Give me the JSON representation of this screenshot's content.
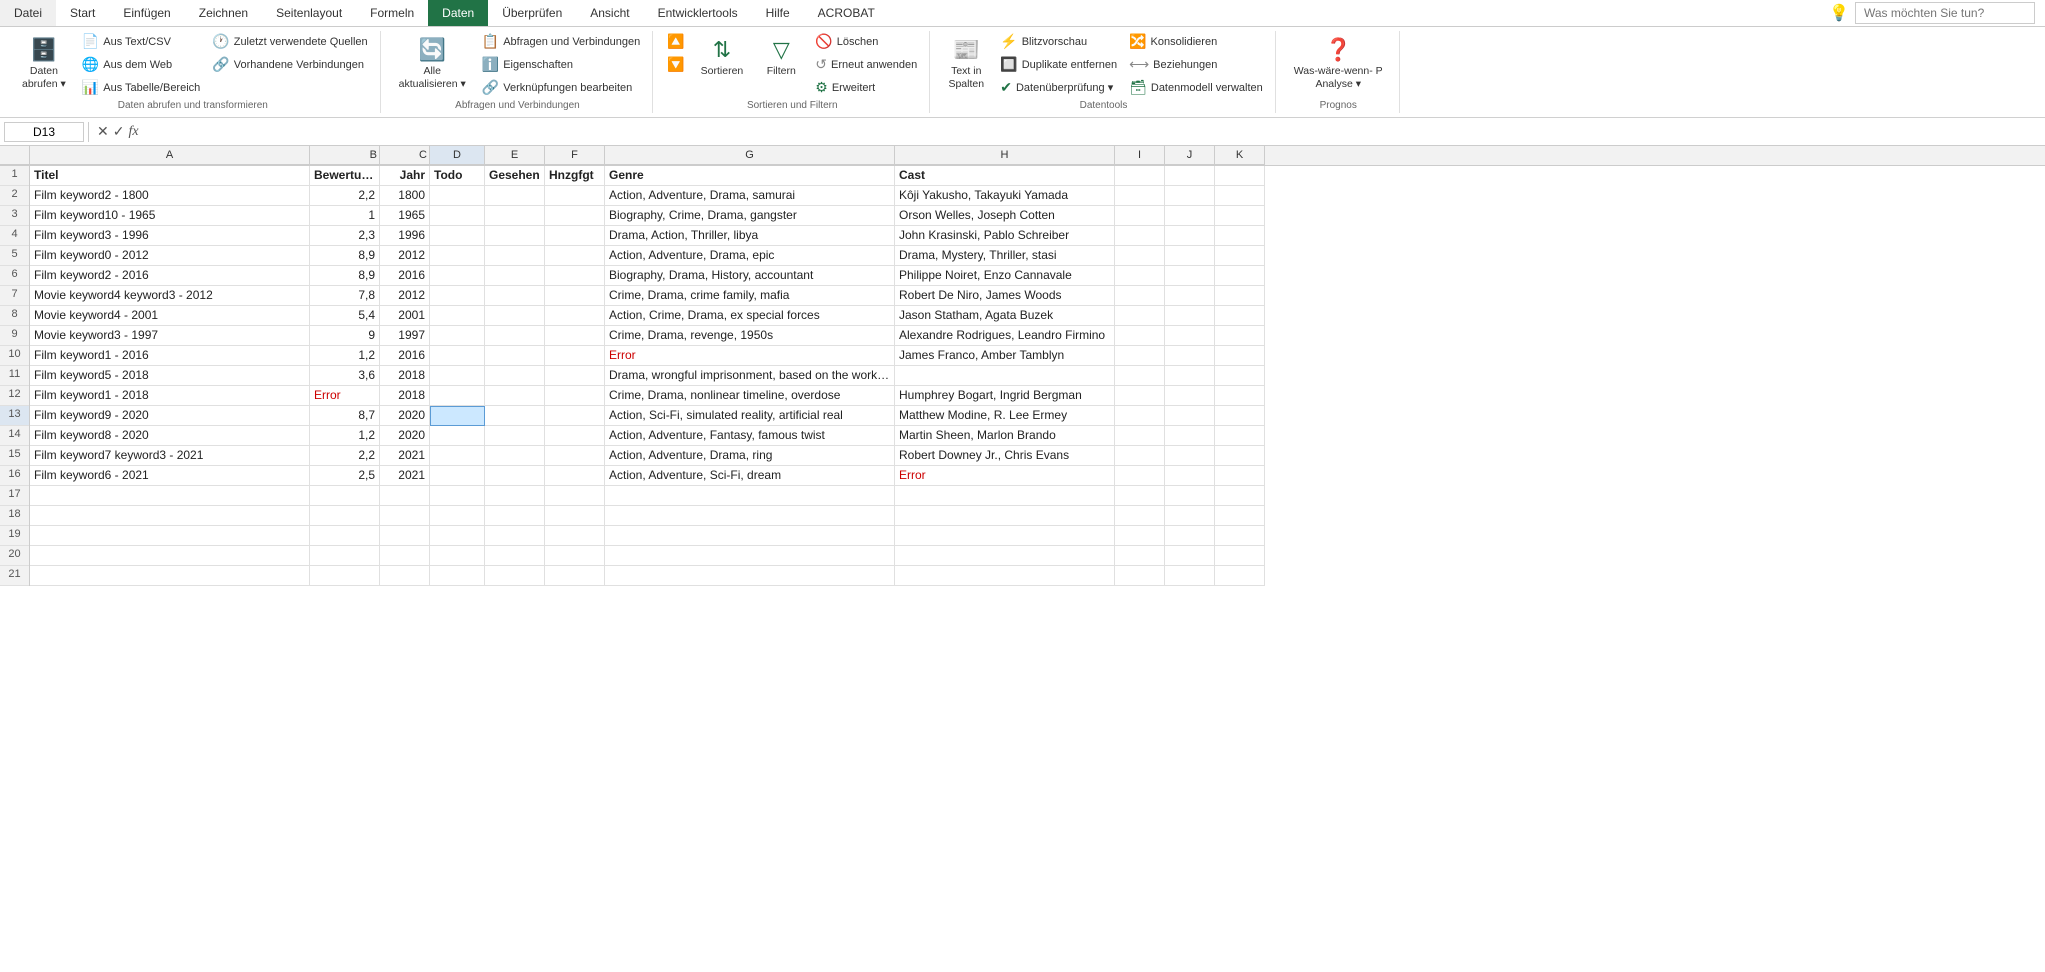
{
  "ribbon": {
    "tabs": [
      {
        "label": "Datei",
        "active": false
      },
      {
        "label": "Start",
        "active": false
      },
      {
        "label": "Einfügen",
        "active": false
      },
      {
        "label": "Zeichnen",
        "active": false
      },
      {
        "label": "Seitenlayout",
        "active": false
      },
      {
        "label": "Formeln",
        "active": false
      },
      {
        "label": "Daten",
        "active": true
      },
      {
        "label": "Überprüfen",
        "active": false
      },
      {
        "label": "Ansicht",
        "active": false
      },
      {
        "label": "Entwicklertools",
        "active": false
      },
      {
        "label": "Hilfe",
        "active": false
      },
      {
        "label": "ACROBAT",
        "active": false
      }
    ],
    "search_placeholder": "Was möchten Sie tun?",
    "groups": {
      "get_data": {
        "label": "Daten abrufen und transformieren",
        "btn_main": "Daten\nabrufen",
        "btn_text_csv": "Aus Text/CSV",
        "btn_web": "Aus dem Web",
        "btn_table": "Aus Tabelle/Bereich",
        "btn_recent": "Zuletzt verwendete Quellen",
        "btn_existing": "Vorhandene Verbindungen"
      },
      "queries": {
        "label": "Abfragen und Verbindungen",
        "btn_all": "Alle\naktualisieren",
        "btn_queries": "Abfragen und Verbindungen",
        "btn_properties": "Eigenschaften",
        "btn_links": "Verknüpfungen bearbeiten"
      },
      "sort_filter": {
        "label": "Sortieren und Filtern",
        "btn_az": "↑",
        "btn_za": "↓",
        "btn_sort": "Sortieren",
        "btn_filter": "Filtern",
        "btn_clear": "Löschen",
        "btn_reapply": "Erneut anwenden",
        "btn_advanced": "Erweitert"
      },
      "data_tools": {
        "label": "Datentools",
        "btn_text_columns": "Text in\nSpalten",
        "btn_flash": "Blitzvorschau",
        "btn_duplicates": "Duplikate entfernen",
        "btn_validation": "Datenüberprüfung",
        "btn_consolidate": "Konsolidieren",
        "btn_relationships": "Beziehungen",
        "btn_model": "Datenmodell verwalten"
      },
      "forecast": {
        "label": "Prognos",
        "btn_whatif": "Was-wäre-wenn- P\nAnalyse"
      }
    }
  },
  "formula_bar": {
    "cell_ref": "D13",
    "formula": ""
  },
  "columns": [
    {
      "label": "A",
      "id": "a"
    },
    {
      "label": "B",
      "id": "b"
    },
    {
      "label": "C",
      "id": "c"
    },
    {
      "label": "D",
      "id": "d"
    },
    {
      "label": "E",
      "id": "e"
    },
    {
      "label": "F",
      "id": "f"
    },
    {
      "label": "G",
      "id": "g"
    },
    {
      "label": "H",
      "id": "h"
    },
    {
      "label": "I",
      "id": "i"
    },
    {
      "label": "J",
      "id": "j"
    },
    {
      "label": "K",
      "id": "k"
    }
  ],
  "rows": [
    {
      "num": "1",
      "cells": [
        "Titel",
        "Bewertung",
        "Jahr",
        "Todo",
        "Gesehen",
        "Hnzgfgt",
        "Genre",
        "Cast",
        "",
        "",
        ""
      ]
    },
    {
      "num": "2",
      "cells": [
        "Film keyword2 - 1800",
        "2,2",
        "1800",
        "",
        "",
        "",
        "Action, Adventure, Drama, samurai",
        "Kôji Yakusho, Takayuki Yamada",
        "",
        "",
        ""
      ]
    },
    {
      "num": "3",
      "cells": [
        "Film keyword10 - 1965",
        "1",
        "1965",
        "",
        "",
        "",
        "Biography, Crime, Drama, gangster",
        "Orson Welles, Joseph Cotten",
        "",
        "",
        ""
      ]
    },
    {
      "num": "4",
      "cells": [
        "Film keyword3 - 1996",
        "2,3",
        "1996",
        "",
        "",
        "",
        "Drama, Action, Thriller, libya",
        "John Krasinski, Pablo Schreiber",
        "",
        "",
        ""
      ]
    },
    {
      "num": "5",
      "cells": [
        "Film keyword0 - 2012",
        "8,9",
        "2012",
        "",
        "",
        "",
        "Action, Adventure, Drama, epic",
        "Drama, Mystery, Thriller, stasi",
        "",
        "",
        ""
      ]
    },
    {
      "num": "6",
      "cells": [
        "Film keyword2 - 2016",
        "8,9",
        "2016",
        "",
        "",
        "",
        "Biography, Drama, History, accountant",
        "Philippe Noiret, Enzo Cannavale",
        "",
        "",
        ""
      ]
    },
    {
      "num": "7",
      "cells": [
        "Movie keyword4 keyword3 - 2012",
        "7,8",
        "2012",
        "",
        "",
        "",
        "Crime, Drama, crime family, mafia",
        "Robert De Niro, James Woods",
        "",
        "",
        ""
      ]
    },
    {
      "num": "8",
      "cells": [
        "Movie keyword4 - 2001",
        "5,4",
        "2001",
        "",
        "",
        "",
        "Action, Crime, Drama, ex special forces",
        "Jason Statham, Agata Buzek",
        "",
        "",
        ""
      ]
    },
    {
      "num": "9",
      "cells": [
        "Movie keyword3 - 1997",
        "9",
        "1997",
        "",
        "",
        "",
        "Crime, Drama, revenge, 1950s",
        "Alexandre Rodrigues, Leandro Firmino",
        "",
        "",
        ""
      ]
    },
    {
      "num": "10",
      "cells": [
        "Film keyword1 - 2016",
        "1,2",
        "2016",
        "",
        "",
        "",
        "Error",
        "James Franco, Amber Tamblyn",
        "",
        "",
        ""
      ]
    },
    {
      "num": "11",
      "cells": [
        "Film keyword5 - 2018",
        "3,6",
        "2018",
        "",
        "",
        "",
        "Drama, wrongful imprisonment, based on the works of stephen king, prison",
        "",
        "",
        "",
        ""
      ]
    },
    {
      "num": "12",
      "cells": [
        "Film keyword1 - 2018",
        "Error",
        "2018",
        "",
        "",
        "",
        "Crime, Drama, nonlinear timeline, overdose",
        "Humphrey Bogart, Ingrid Bergman",
        "",
        "",
        ""
      ]
    },
    {
      "num": "13",
      "cells": [
        "Film keyword9 - 2020",
        "8,7",
        "2020",
        "",
        "",
        "",
        "Action, Sci-Fi, simulated reality, artificial real",
        "Matthew Modine, R. Lee Ermey",
        "",
        "",
        ""
      ]
    },
    {
      "num": "14",
      "cells": [
        "Film keyword8 - 2020",
        "1,2",
        "2020",
        "",
        "",
        "",
        "Action, Adventure, Fantasy, famous twist",
        "Martin Sheen, Marlon Brando",
        "",
        "",
        ""
      ]
    },
    {
      "num": "15",
      "cells": [
        "Film keyword7 keyword3 - 2021",
        "2,2",
        "2021",
        "",
        "",
        "",
        "Action, Adventure, Drama, ring",
        "Robert Downey Jr., Chris Evans",
        "",
        "",
        ""
      ]
    },
    {
      "num": "16",
      "cells": [
        "Film keyword6 - 2021",
        "2,5",
        "2021",
        "",
        "",
        "",
        "Action, Adventure, Sci-Fi, dream",
        "Error",
        "",
        "",
        ""
      ]
    },
    {
      "num": "17",
      "cells": [
        "",
        "",
        "",
        "",
        "",
        "",
        "",
        "",
        "",
        "",
        ""
      ]
    },
    {
      "num": "18",
      "cells": [
        "",
        "",
        "",
        "",
        "",
        "",
        "",
        "",
        "",
        "",
        ""
      ]
    },
    {
      "num": "19",
      "cells": [
        "",
        "",
        "",
        "",
        "",
        "",
        "",
        "",
        "",
        "",
        ""
      ]
    },
    {
      "num": "20",
      "cells": [
        "",
        "",
        "",
        "",
        "",
        "",
        "",
        "",
        "",
        "",
        ""
      ]
    },
    {
      "num": "21",
      "cells": [
        "",
        "",
        "",
        "",
        "",
        "",
        "",
        "",
        "",
        "",
        ""
      ]
    }
  ]
}
